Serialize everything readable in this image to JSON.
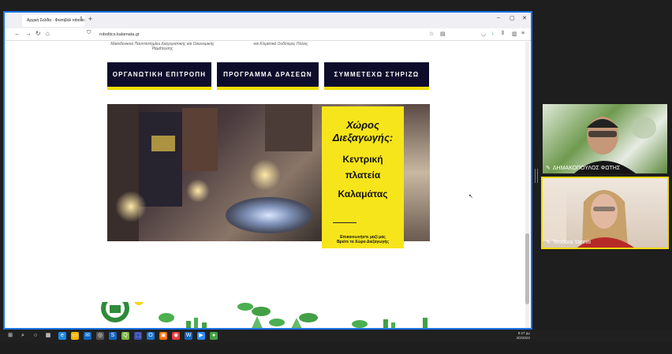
{
  "browser": {
    "tab_title": "Αρχική Σελίδα - Φεστιβάλ roboltics.kalamata",
    "tab_close": "×",
    "new_tab": "+",
    "url": "roboltics.kalamata.gr",
    "window_controls": [
      "–",
      "▢",
      "✕"
    ]
  },
  "page": {
    "subtext_left": "Μακεδονικού Πανεπιστημίου Διαχειριστικής και Οικονομικής Ραμάτευσης",
    "subtext_right": "και Κλιματικά Ουδέτερες Πόλεις",
    "buttons": [
      {
        "label": "ΟΡΓΑΝΩΤΙΚΗ ΕΠΙΤΡΟΠΗ"
      },
      {
        "label": "ΠΡΟΓΡΑΜΜΑ ΔΡΑΣΕΩΝ"
      },
      {
        "label": "ΣΥΜΜΕΤΕΧΩ ΣΤΗΡΙΖΩ"
      }
    ],
    "banner": {
      "title_line1": "Χώρος",
      "title_line2": "Διεξαγωγής:",
      "place_line1": "Κεντρική",
      "place_line2": "πλατεία",
      "place_line3": "Καλαμάτας",
      "contact_line1": "Επικοινωνήστε μαζί μας",
      "contact_line2": "Βρείτε το Χώρο Διεξαγωγής"
    },
    "scroll_top": "∧"
  },
  "video": {
    "participant1": "ΔΗΜΑΚΟΠΟΥΛΟΣ ΦΩΤΗΣ",
    "participant2": "Teodora Yanniti"
  },
  "taskbar": {
    "time": "8:27 μμ",
    "date": "3/2/2022"
  },
  "colors": {
    "accent_blue": "#1a73e8",
    "button_bg": "#0d0d2b",
    "yellow": "#f7e51b",
    "active_speaker": "#f2dc00"
  }
}
